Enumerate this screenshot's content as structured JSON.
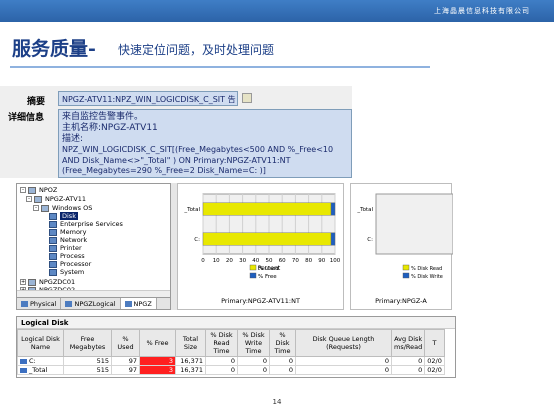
{
  "header": {
    "company": "上海晶晨信息科技有限公司"
  },
  "slide": {
    "title": "服务质量-",
    "subtitle": "快速定位问题，及时处理问题",
    "page_number": "14"
  },
  "alert": {
    "summary_label": "摘要",
    "summary_value": "NPGZ-ATV11:NPZ_WIN_LOGICDISK_C_SIT 告",
    "detail_label": "详细信息",
    "detail_lines": [
      "来自监控告警事件。",
      "主机名称:NPGZ-ATV11",
      "描述:",
      "NPZ_WIN_LOGICDISK_C_SIT[(Free_Megabytes<500 AND %_Free<10",
      "AND Disk_Name<>\"_Total\" ) ON Primary:NPGZ-ATV11:NT",
      "(Free_Megabytes=290 %_Free=2 Disk_Name=C: )]"
    ]
  },
  "tree": {
    "items": [
      "NPOZ",
      "NPGZ-ATV11",
      "Windows OS",
      "Disk",
      "Enterprise Services",
      "Memory",
      "Network",
      "Printer",
      "Process",
      "Processor",
      "System",
      "NPGZDC01",
      "NPGZDC02"
    ],
    "tabs": [
      "Physical",
      "NPGZLogical",
      "NPGZ"
    ]
  },
  "chart_data": [
    {
      "type": "bar",
      "orientation": "horizontal",
      "stacked": true,
      "categories": [
        "_Total",
        "C:"
      ],
      "series": [
        {
          "name": "% Used",
          "values": [
            97,
            97
          ],
          "color": "#e8e800"
        },
        {
          "name": "% Free",
          "values": [
            3,
            3
          ],
          "color": "#1f5fbf"
        }
      ],
      "xlabel": "Percent",
      "xlim": [
        0,
        100
      ],
      "xticks": [
        0,
        10,
        20,
        30,
        40,
        50,
        60,
        70,
        80,
        90,
        100
      ],
      "caption": "Primary:NPGZ-ATV11:NT",
      "legend": "bottom"
    },
    {
      "type": "bar",
      "orientation": "horizontal",
      "categories": [
        "_Total",
        "C:"
      ],
      "series": [
        {
          "name": "% Disk Read",
          "values": [],
          "color": "#e8e800"
        },
        {
          "name": "% Disk Write",
          "values": [],
          "color": "#1f5fbf"
        }
      ],
      "caption": "Primary:NPGZ-A",
      "legend": "bottom"
    }
  ],
  "table": {
    "title": "Logical Disk",
    "columns": [
      "Logical Disk Name",
      "Free Megabytes",
      "% Used",
      "% Free",
      "Total Size",
      "% Disk Read Time",
      "% Disk Write Time",
      "% Disk Time",
      "Disk Queue Length (Requests)",
      "Avg Disk ms/Read",
      "T"
    ],
    "rows": [
      [
        "C:",
        "515",
        "97",
        "3",
        "16,371",
        "0",
        "0",
        "0",
        "0",
        "0",
        "02/0"
      ],
      [
        "_Total",
        "515",
        "97",
        "3",
        "16,371",
        "0",
        "0",
        "0",
        "0",
        "0",
        "02/0"
      ]
    ]
  }
}
